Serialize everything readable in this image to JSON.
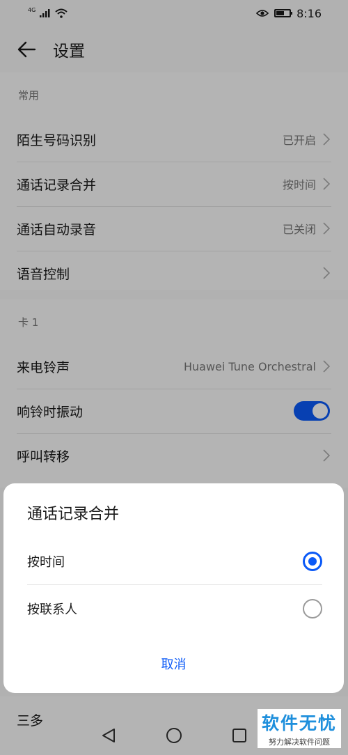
{
  "status_bar": {
    "network": "4G",
    "time": "8:16"
  },
  "header": {
    "title": "设置"
  },
  "sections": [
    {
      "title": "常用",
      "items": [
        {
          "label": "陌生号码识别",
          "value": "已开启"
        },
        {
          "label": "通话记录合并",
          "value": "按时间"
        },
        {
          "label": "通话自动录音",
          "value": "已关闭"
        },
        {
          "label": "语音控制"
        }
      ]
    },
    {
      "title": "卡 1",
      "items": [
        {
          "label": "来电铃声",
          "value": "Huawei Tune Orchestral"
        },
        {
          "label": "响铃时振动",
          "toggle": true
        },
        {
          "label": "呼叫转移"
        }
      ]
    }
  ],
  "tail_partial_label": "三多",
  "dialog": {
    "title": "通话记录合并",
    "options": [
      {
        "label": "按时间",
        "selected": true
      },
      {
        "label": "按联系人",
        "selected": false
      }
    ],
    "cancel_label": "取消"
  },
  "watermark": {
    "main": "软件无忧",
    "sub": "努力解决软件问题"
  },
  "colors": {
    "accent": "#0a59f7",
    "watermark": "#1e8fdc"
  }
}
